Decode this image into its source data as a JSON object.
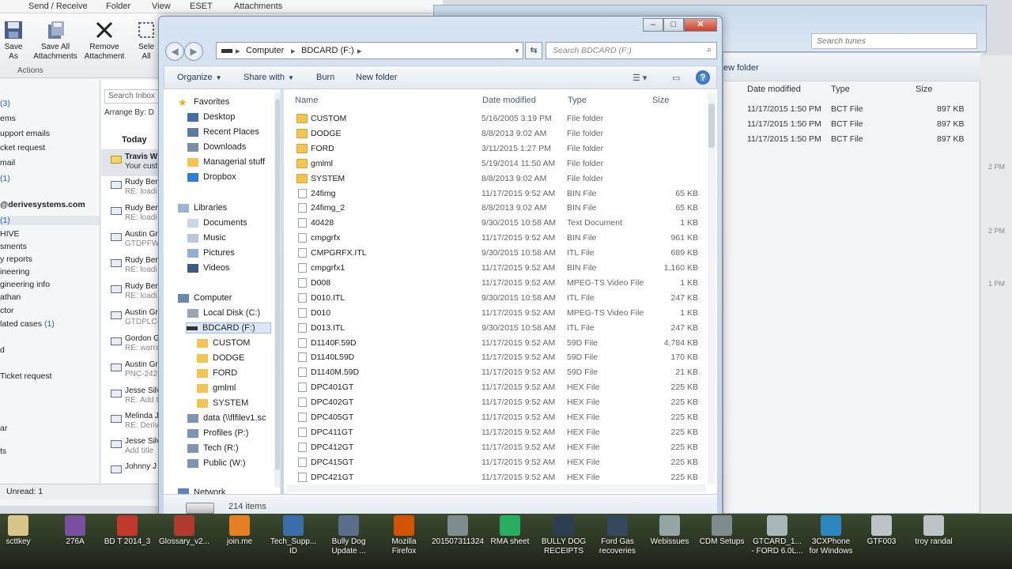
{
  "outlook": {
    "tabs": [
      "Send / Receive",
      "Folder",
      "View",
      "ESET",
      "Attachments"
    ],
    "ribbon_buttons": [
      {
        "label": "Save\nAs",
        "icon": "save-as-icon"
      },
      {
        "label": "Save All\nAttachments",
        "icon": "save-all-icon"
      },
      {
        "label": "Remove\nAttachment",
        "icon": "remove-icon"
      },
      {
        "label": "Sele\nAll",
        "icon": "select-icon"
      }
    ],
    "group_label": "Actions",
    "folders": [
      {
        "text": "(3)",
        "count": ""
      },
      {
        "text": "ems",
        "count": ""
      },
      {
        "text": "upport emails",
        "count": ""
      },
      {
        "text": "cket request",
        "count": ""
      },
      {
        "text": "mail",
        "count": ""
      },
      {
        "text": "(1)",
        "count": ""
      },
      {
        "text": "@derivesystems.com",
        "count": ""
      },
      {
        "text": "(1)",
        "count": ""
      },
      {
        "text": "HIVE",
        "count": ""
      },
      {
        "text": "sments",
        "count": ""
      },
      {
        "text": "y reports",
        "count": ""
      },
      {
        "text": "ineering",
        "count": ""
      },
      {
        "text": "gineering info",
        "count": ""
      },
      {
        "text": "athan",
        "count": ""
      },
      {
        "text": "ctor",
        "count": ""
      },
      {
        "text": "lated cases",
        "count": "(1)"
      },
      {
        "text": "d",
        "count": ""
      },
      {
        "text": "Ticket request",
        "count": ""
      }
    ],
    "folders_bottom": [
      "ar",
      "ts"
    ],
    "search_placeholder": "Search Inbox",
    "arrange": "Arrange By: D",
    "today": "Today",
    "messages": [
      {
        "from": "Travis W",
        "sub": "Your cust"
      },
      {
        "from": "Rudy Ben",
        "sub": "RE: loadi"
      },
      {
        "from": "Rudy Ben",
        "sub": "RE: loadi"
      },
      {
        "from": "Austin Gr",
        "sub": "GTDPFW"
      },
      {
        "from": "Rudy Ben",
        "sub": "RE: loadi"
      },
      {
        "from": "Rudy Ben",
        "sub": "RE: loadi"
      },
      {
        "from": "Austin Gr",
        "sub": "GTDPLC-"
      },
      {
        "from": "Gordon G",
        "sub": "RE: warra"
      },
      {
        "from": "Austin Gr",
        "sub": "PNC-242"
      },
      {
        "from": "Jesse Silv",
        "sub": "RE: Add t"
      },
      {
        "from": "Melinda J",
        "sub": "RE: Deriv"
      },
      {
        "from": "Jesse Silv",
        "sub": "Add title"
      },
      {
        "from": "Johnny J",
        "sub": ""
      }
    ],
    "status": "Unread: 1"
  },
  "bg_window": {
    "search_placeholder": "Search tunes",
    "new_folder": "ew folder",
    "columns": [
      "Date modified",
      "Type",
      "Size"
    ],
    "rows": [
      {
        "date": "11/17/2015 1:50 PM",
        "type": "BCT File",
        "size": "897 KB"
      },
      {
        "date": "11/17/2015 1:50 PM",
        "type": "BCT File",
        "size": "897 KB"
      },
      {
        "date": "11/17/2015 1:50 PM",
        "type": "BCT File",
        "size": "897 KB"
      }
    ],
    "edge_labels": [
      "2 PM",
      "2 PM",
      "1 PM"
    ]
  },
  "explorer": {
    "address": [
      "Computer",
      "BDCARD (F:)"
    ],
    "search_placeholder": "Search BDCARD (F:)",
    "toolbar": {
      "organize": "Organize",
      "share": "Share with",
      "burn": "Burn",
      "new_folder": "New folder"
    },
    "nav": {
      "favorites": "Favorites",
      "favorites_items": [
        "Desktop",
        "Recent Places",
        "Downloads",
        "Managerial stuff",
        "Dropbox"
      ],
      "libraries": "Libraries",
      "libraries_items": [
        "Documents",
        "Music",
        "Pictures",
        "Videos"
      ],
      "computer": "Computer",
      "drives": [
        "Local Disk (C:)",
        "BDCARD (F:)"
      ],
      "bdcard_children": [
        "CUSTOM",
        "DODGE",
        "FORD",
        "gmlml",
        "SYSTEM"
      ],
      "network_drives": [
        "data (\\\\flfilev1.sc",
        "Profiles (P:)",
        "Tech (R:)",
        "Public (W:)"
      ],
      "network": "Network"
    },
    "columns": {
      "name": "Name",
      "date": "Date modified",
      "type": "Type",
      "size": "Size"
    },
    "files": [
      {
        "name": "CUSTOM",
        "date": "5/16/2005 3:19 PM",
        "type": "File folder",
        "size": "",
        "folder": true
      },
      {
        "name": "DODGE",
        "date": "8/8/2013 9:02 AM",
        "type": "File folder",
        "size": "",
        "folder": true
      },
      {
        "name": "FORD",
        "date": "3/11/2015 1:27 PM",
        "type": "File folder",
        "size": "",
        "folder": true
      },
      {
        "name": "gmlml",
        "date": "5/19/2014 11:50 AM",
        "type": "File folder",
        "size": "",
        "folder": true
      },
      {
        "name": "SYSTEM",
        "date": "8/8/2013 9:02 AM",
        "type": "File folder",
        "size": "",
        "folder": true
      },
      {
        "name": "24fimg",
        "date": "11/17/2015 9:52 AM",
        "type": "BIN File",
        "size": "65 KB",
        "folder": false
      },
      {
        "name": "24fimg_2",
        "date": "8/8/2013 9:02 AM",
        "type": "BIN File",
        "size": "65 KB",
        "folder": false
      },
      {
        "name": "40428",
        "date": "9/30/2015 10:58 AM",
        "type": "Text Document",
        "size": "1 KB",
        "folder": false
      },
      {
        "name": "cmpgrfx",
        "date": "11/17/2015 9:52 AM",
        "type": "BIN File",
        "size": "961 KB",
        "folder": false
      },
      {
        "name": "CMPGRFX.ITL",
        "date": "9/30/2015 10:58 AM",
        "type": "ITL File",
        "size": "689 KB",
        "folder": false
      },
      {
        "name": "cmpgrfx1",
        "date": "11/17/2015 9:52 AM",
        "type": "BIN File",
        "size": "1,160 KB",
        "folder": false
      },
      {
        "name": "D008",
        "date": "11/17/2015 9:52 AM",
        "type": "MPEG-TS Video File",
        "size": "1 KB",
        "folder": false
      },
      {
        "name": "D010.ITL",
        "date": "9/30/2015 10:58 AM",
        "type": "ITL File",
        "size": "247 KB",
        "folder": false
      },
      {
        "name": "D010",
        "date": "11/17/2015 9:52 AM",
        "type": "MPEG-TS Video File",
        "size": "1 KB",
        "folder": false
      },
      {
        "name": "D013.ITL",
        "date": "9/30/2015 10:58 AM",
        "type": "ITL File",
        "size": "247 KB",
        "folder": false
      },
      {
        "name": "D1140F.59D",
        "date": "11/17/2015 9:52 AM",
        "type": "59D File",
        "size": "4,784 KB",
        "folder": false
      },
      {
        "name": "D1140L59D",
        "date": "11/17/2015 9:52 AM",
        "type": "59D File",
        "size": "170 KB",
        "folder": false
      },
      {
        "name": "D1140M.59D",
        "date": "11/17/2015 9:52 AM",
        "type": "59D File",
        "size": "21 KB",
        "folder": false
      },
      {
        "name": "DPC401GT",
        "date": "11/17/2015 9:52 AM",
        "type": "HEX File",
        "size": "225 KB",
        "folder": false
      },
      {
        "name": "DPC402GT",
        "date": "11/17/2015 9:52 AM",
        "type": "HEX File",
        "size": "225 KB",
        "folder": false
      },
      {
        "name": "DPC405GT",
        "date": "11/17/2015 9:52 AM",
        "type": "HEX File",
        "size": "225 KB",
        "folder": false
      },
      {
        "name": "DPC411GT",
        "date": "11/17/2015 9:52 AM",
        "type": "HEX File",
        "size": "225 KB",
        "folder": false
      },
      {
        "name": "DPC412GT",
        "date": "11/17/2015 9:52 AM",
        "type": "HEX File",
        "size": "225 KB",
        "folder": false
      },
      {
        "name": "DPC415GT",
        "date": "11/17/2015 9:52 AM",
        "type": "HEX File",
        "size": "225 KB",
        "folder": false
      },
      {
        "name": "DPC421GT",
        "date": "11/17/2015 9:52 AM",
        "type": "HEX File",
        "size": "225 KB",
        "folder": false
      }
    ],
    "item_count": "214 items"
  },
  "desktop": {
    "icons": [
      {
        "label": "scttkey",
        "color": "#d9c48a"
      },
      {
        "label": "276A",
        "color": "#7a4fa0"
      },
      {
        "label": "BD T 2014_3",
        "color": "#c0392b"
      },
      {
        "label": "Glossary_v2...",
        "color": "#b03a2e"
      },
      {
        "label": "join.me",
        "color": "#e67e22"
      },
      {
        "label": "Tech_Supp...\nID",
        "color": "#3b6ea8"
      },
      {
        "label": "Bully Dog\nUpdate ...",
        "color": "#5a6e8c"
      },
      {
        "label": "Mozilla\nFirefox",
        "color": "#d35400"
      },
      {
        "label": "201507311324",
        "color": "#7f8c8d"
      },
      {
        "label": "RMA sheet",
        "color": "#27ae60"
      },
      {
        "label": "BULLY DOG\nRECEIPTS",
        "color": "#2c3e50"
      },
      {
        "label": "Ford Gas\nrecoveries",
        "color": "#34495e"
      },
      {
        "label": "Webissues",
        "color": "#95a5a6"
      },
      {
        "label": "CDM Setups",
        "color": "#7f8c8d"
      },
      {
        "label": "GTCARD_1...\n- FORD 6.0L...",
        "color": "#aab7b8"
      },
      {
        "label": "3CXPhone\nfor Windows",
        "color": "#2e86c1"
      },
      {
        "label": "GTF003",
        "color": "#bdc3c7"
      },
      {
        "label": "troy randal",
        "color": "#bdc3c7"
      }
    ]
  }
}
